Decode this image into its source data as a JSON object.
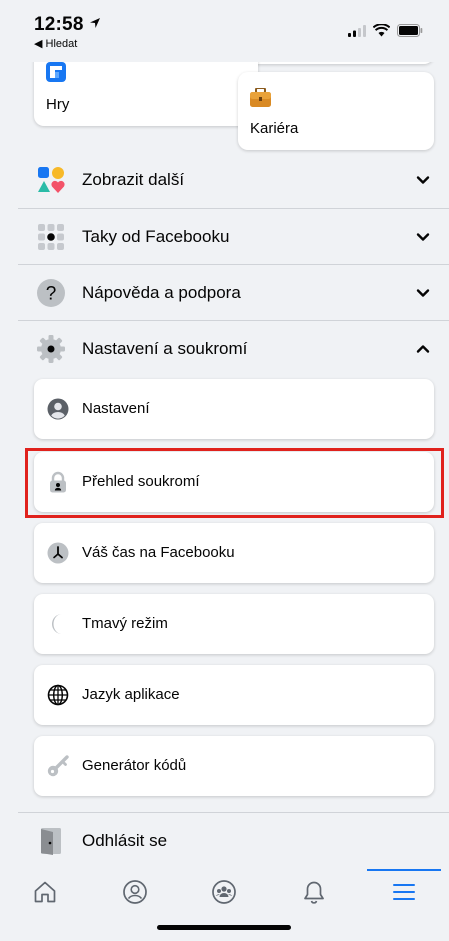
{
  "status_bar": {
    "time": "12:58",
    "back_label": "◀ Hledat"
  },
  "shortcuts": [
    {
      "label": "Hry",
      "icon": "games-icon"
    },
    {
      "label": "Kariéra",
      "icon": "briefcase-icon"
    }
  ],
  "menu": {
    "show_more": "Zobrazit další",
    "also_from_facebook": "Taky od Facebooku",
    "help_support": "Nápověda a podpora",
    "settings_privacy": "Nastavení a soukromí",
    "logout": "Odhlásit se"
  },
  "settings_items": [
    {
      "label": "Nastavení",
      "icon": "profile-icon"
    },
    {
      "label": "Přehled soukromí",
      "icon": "lock-icon"
    },
    {
      "label": "Váš čas na Facebooku",
      "icon": "clock-icon"
    },
    {
      "label": "Tmavý režim",
      "icon": "moon-icon"
    },
    {
      "label": "Jazyk aplikace",
      "icon": "globe-icon"
    },
    {
      "label": "Generátor kódů",
      "icon": "key-icon"
    }
  ],
  "colors": {
    "accent": "#1877f2",
    "highlight": "#e0221d",
    "background": "#f0f2f5"
  },
  "nav": [
    "home-icon",
    "profile-icon",
    "groups-icon",
    "bell-icon",
    "menu-icon"
  ]
}
